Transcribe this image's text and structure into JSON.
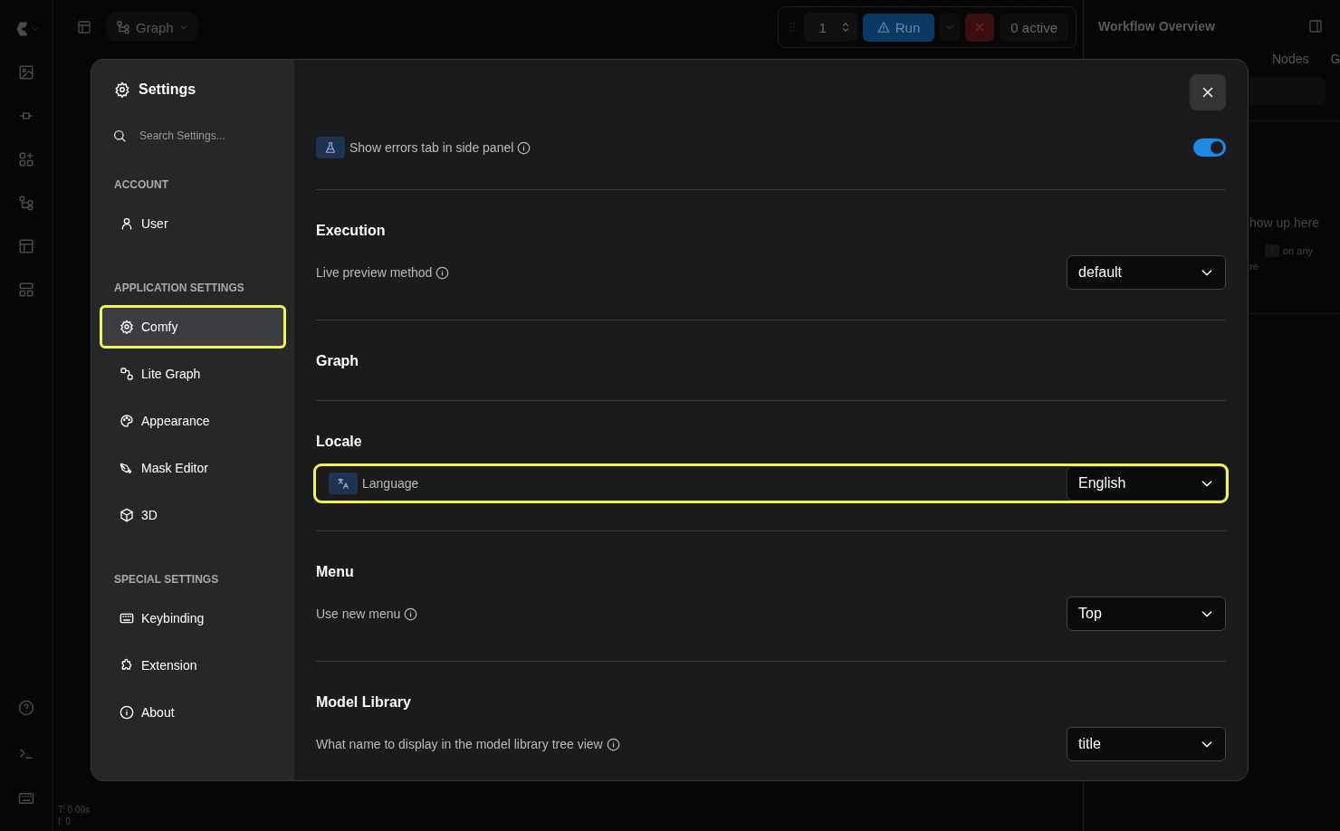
{
  "topbar": {
    "graph_button": "Graph"
  },
  "run_toolbar": {
    "batch_count": "1",
    "run_label": "Run",
    "active_count": "0 active"
  },
  "right_panel": {
    "title": "Workflow Overview",
    "tabs": [
      "Nodes",
      "G"
    ],
    "hint_lines": [
      "how up here",
      "on any",
      "re"
    ]
  },
  "canvas_stats": [
    "T: 0.00s",
    "I: 0"
  ],
  "settings": {
    "title": "Settings",
    "search_placeholder": "Search Settings...",
    "nav_groups": [
      {
        "heading": "ACCOUNT",
        "items": [
          {
            "label": "User",
            "selected": false
          }
        ]
      },
      {
        "heading": "APPLICATION SETTINGS",
        "items": [
          {
            "label": "Comfy",
            "selected": true
          },
          {
            "label": "Lite Graph",
            "selected": false
          },
          {
            "label": "Appearance",
            "selected": false
          },
          {
            "label": "Mask Editor",
            "selected": false
          },
          {
            "label": "3D",
            "selected": false
          }
        ]
      },
      {
        "heading": "SPECIAL SETTINGS",
        "items": [
          {
            "label": "Keybinding",
            "selected": false
          },
          {
            "label": "Extension",
            "selected": false
          },
          {
            "label": "About",
            "selected": false
          }
        ]
      }
    ],
    "sections": [
      {
        "settings": [
          {
            "kind": "toggle",
            "label": "Show errors tab in side panel",
            "info": true,
            "on": true,
            "highlighted": false
          }
        ]
      },
      {
        "title": "Execution",
        "settings": [
          {
            "kind": "select",
            "label": "Live preview method",
            "info": true,
            "value": "default",
            "highlighted": false
          }
        ]
      },
      {
        "title": "Graph"
      },
      {
        "title": "Locale",
        "settings": [
          {
            "kind": "select",
            "label": "Language",
            "info": false,
            "value": "English",
            "highlighted": true
          }
        ]
      },
      {
        "title": "Menu",
        "settings": [
          {
            "kind": "select",
            "label": "Use new menu",
            "info": true,
            "value": "Top",
            "highlighted": false
          }
        ]
      },
      {
        "title": "Model Library",
        "settings": [
          {
            "kind": "select",
            "label": "What name to display in the model library tree view",
            "info": true,
            "value": "title",
            "highlighted": false
          }
        ]
      }
    ]
  }
}
